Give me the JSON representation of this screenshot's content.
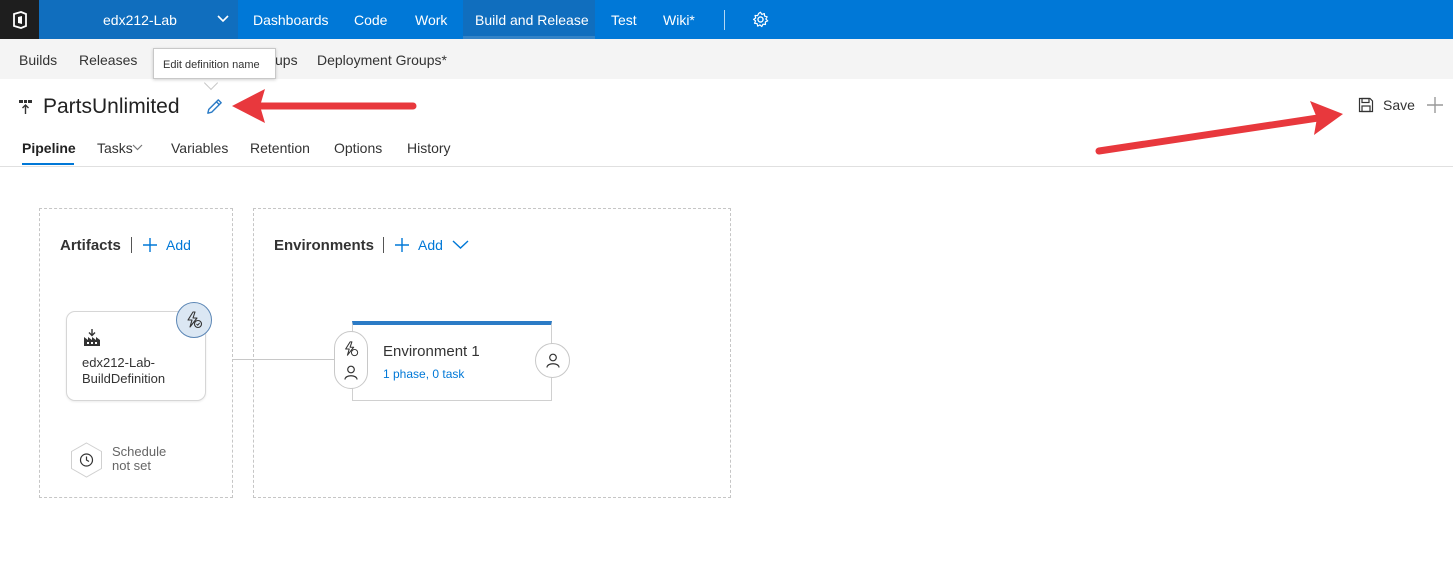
{
  "topbar": {
    "project": "edx212-Lab",
    "nav": [
      "Dashboards",
      "Code",
      "Work",
      "Build and Release",
      "Test",
      "Wiki*"
    ],
    "active_nav": "Build and Release",
    "colors": {
      "bar": "#0078d7",
      "logo_bg": "#1e1e1e"
    }
  },
  "subnav": {
    "items": [
      "Builds",
      "Releases",
      "ups",
      "Deployment Groups*"
    ]
  },
  "tooltip": {
    "text": "Edit definition name"
  },
  "definition": {
    "title": "PartsUnlimited",
    "icon": "release-definition-icon",
    "edit_icon": "pencil-icon"
  },
  "toolbar": {
    "save_label": "Save",
    "save_icon": "floppy-disk-icon"
  },
  "tabs": [
    {
      "label": "Pipeline",
      "active": true
    },
    {
      "label": "Tasks",
      "has_dropdown": true
    },
    {
      "label": "Variables"
    },
    {
      "label": "Retention"
    },
    {
      "label": "Options"
    },
    {
      "label": "History"
    }
  ],
  "artifacts": {
    "title": "Artifacts",
    "add_label": "Add",
    "card_name": "edx212-Lab-BuildDefinition",
    "card_name_lines": [
      "edx212-Lab-",
      "BuildDefinition"
    ],
    "schedule_lines": [
      "Schedule",
      "not set"
    ]
  },
  "environments": {
    "title": "Environments",
    "add_label": "Add",
    "card_name": "Environment 1",
    "card_detail": "1 phase, 0 task"
  },
  "annotation_color": "#e8383d"
}
